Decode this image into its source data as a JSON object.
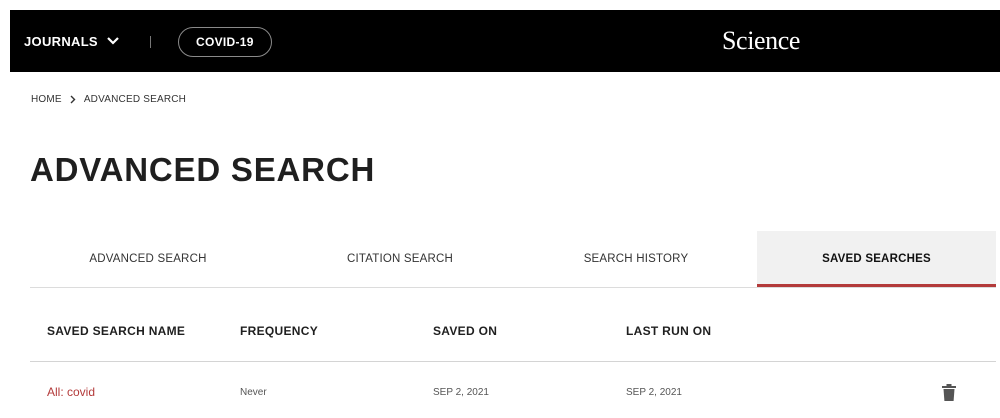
{
  "nav": {
    "journals": "JOURNALS",
    "covid": "COVID-19",
    "logo": "Science"
  },
  "breadcrumb": {
    "home": "HOME",
    "current": "ADVANCED SEARCH"
  },
  "page": {
    "title": "ADVANCED SEARCH"
  },
  "tabs": [
    {
      "label": "ADVANCED SEARCH",
      "active": false
    },
    {
      "label": "CITATION SEARCH",
      "active": false
    },
    {
      "label": "SEARCH HISTORY",
      "active": false
    },
    {
      "label": "SAVED SEARCHES",
      "active": true
    }
  ],
  "table": {
    "headers": [
      "SAVED SEARCH NAME",
      "FREQUENCY",
      "SAVED ON",
      "LAST RUN ON"
    ],
    "rows": [
      {
        "name": "All: covid",
        "frequency": "Never",
        "saved_on": "SEP 2, 2021",
        "last_run_on": "SEP 2, 2021"
      }
    ]
  },
  "colors": {
    "accent": "#b33a3a",
    "topbar": "#000000",
    "active_tab_bg": "#f1f1f1"
  },
  "icons": {
    "journals_dropdown": "chevron-down-icon",
    "breadcrumb_separator": "chevron-right-icon",
    "delete": "trash-icon"
  }
}
